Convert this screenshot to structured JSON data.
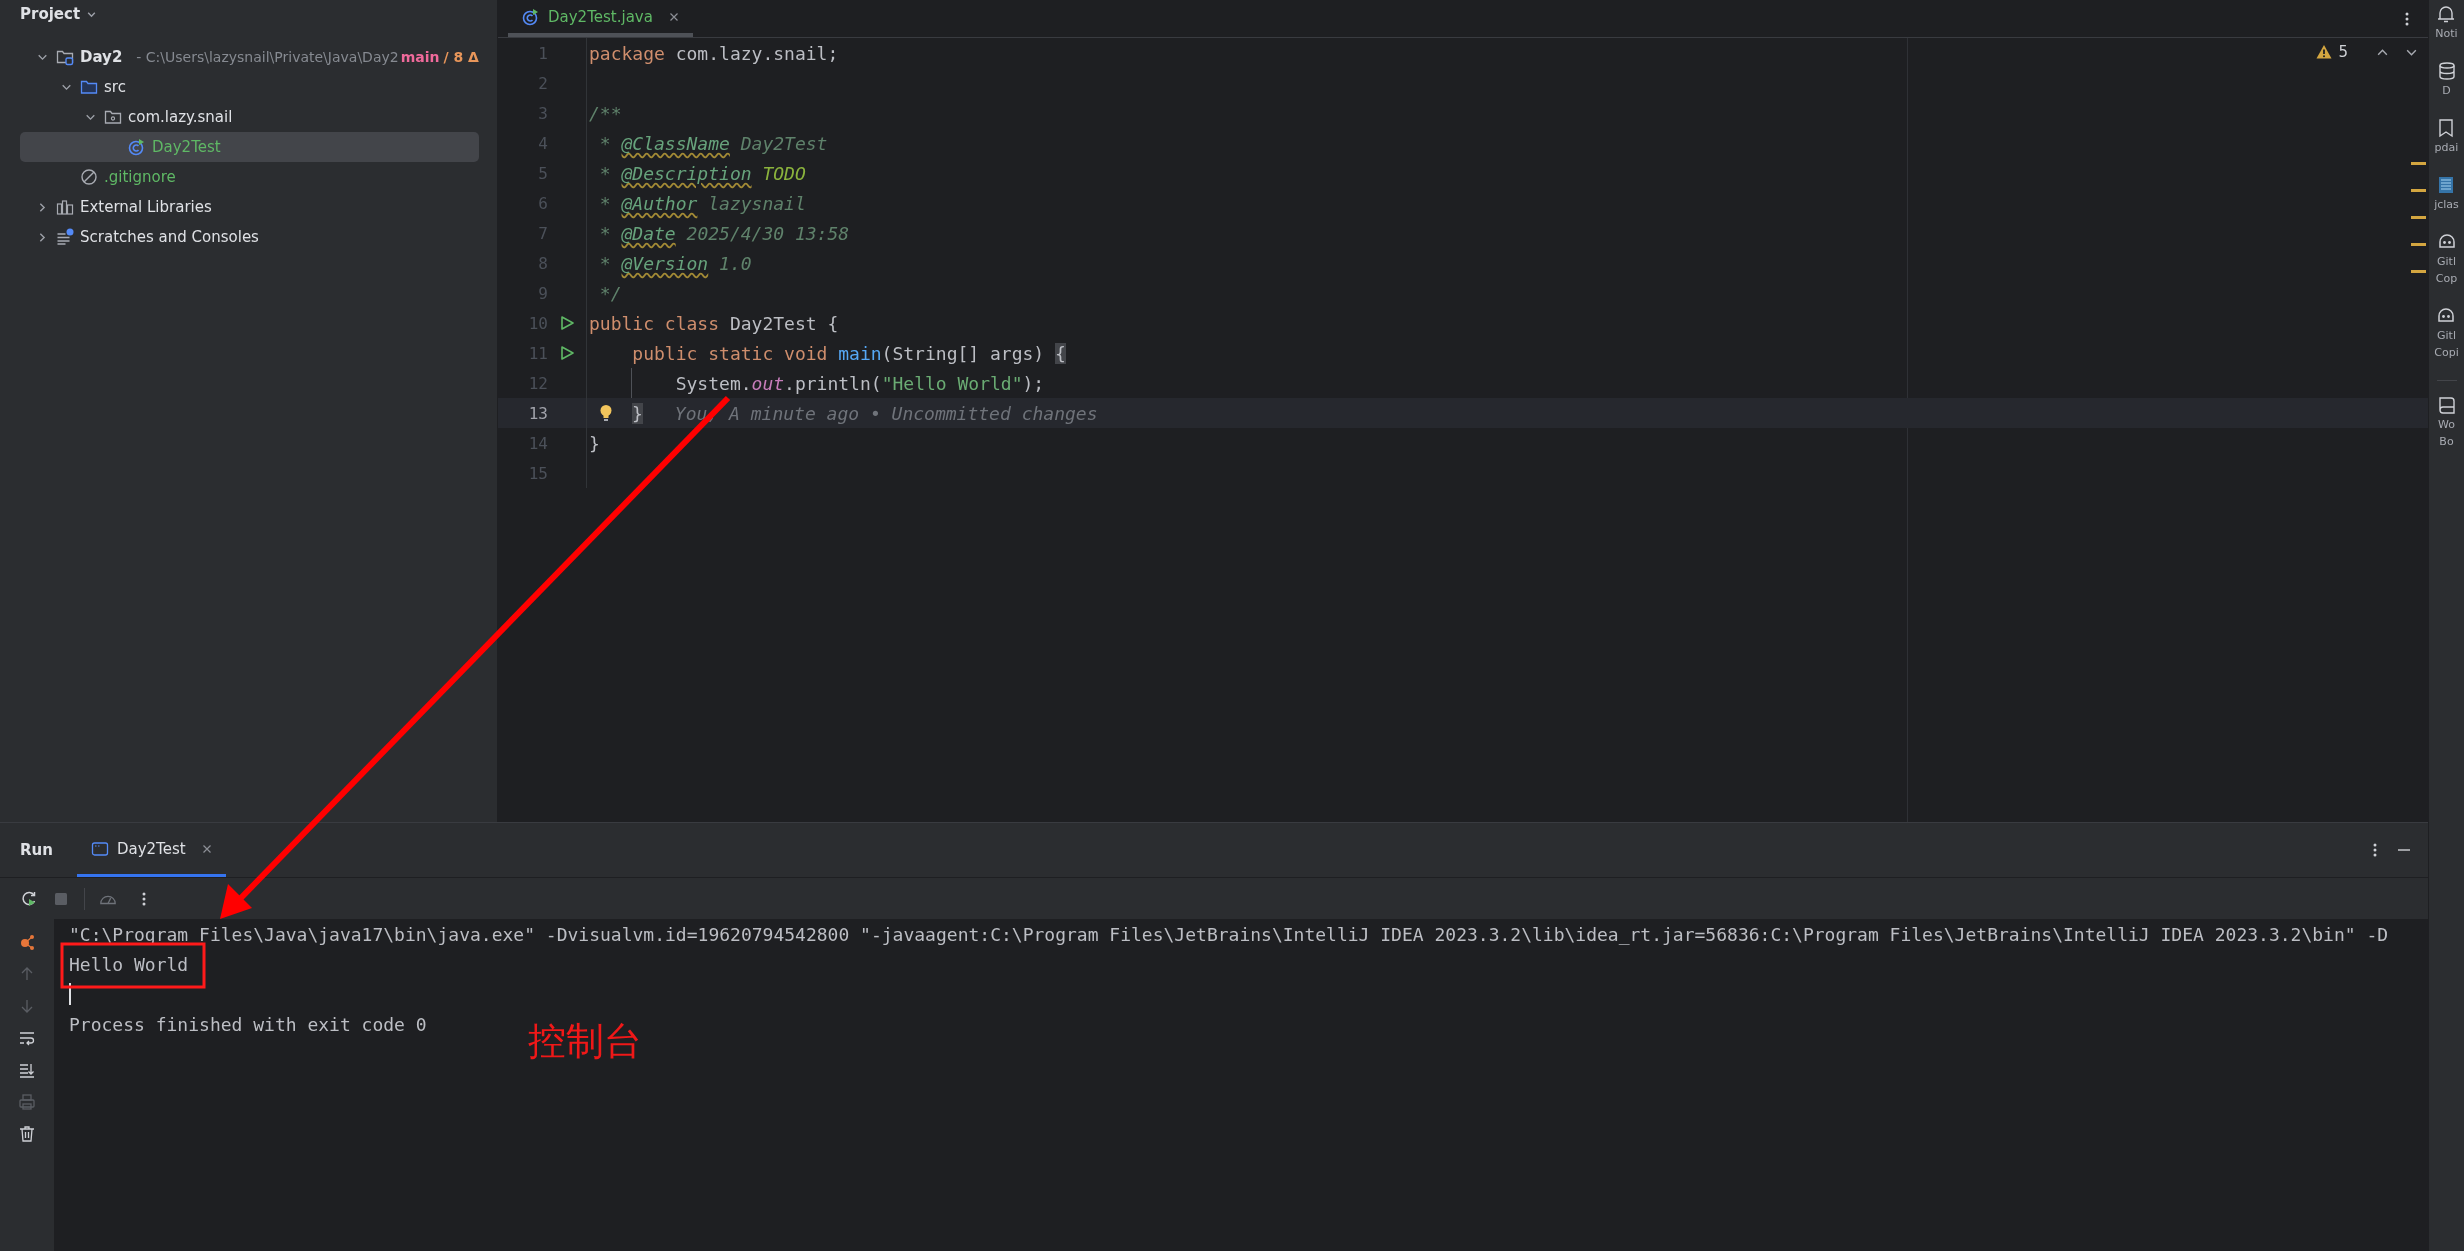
{
  "project_panel": {
    "title": "Project",
    "tree": [
      {
        "name": "Day2",
        "kind": "module",
        "path": "- C:\\Users\\lazysnail\\Private\\Java\\Day2",
        "branch": "main",
        "changes": "/ 8 Δ",
        "expanded": true,
        "selected": false,
        "children": [
          {
            "name": "src",
            "kind": "folder",
            "expanded": true,
            "selected": false,
            "children": [
              {
                "name": "com.lazy.snail",
                "kind": "package",
                "expanded": true,
                "selected": false,
                "children": [
                  {
                    "name": "Day2Test",
                    "kind": "class",
                    "color": "#5fb865",
                    "selected": true
                  }
                ]
              }
            ]
          },
          {
            "name": ".gitignore",
            "kind": "ignore",
            "color": "#5fb865",
            "selected": false
          }
        ]
      },
      {
        "name": "External Libraries",
        "kind": "libraries",
        "expanded": false,
        "selected": false
      },
      {
        "name": "Scratches and Consoles",
        "kind": "scratches",
        "expanded": false,
        "selected": false
      }
    ]
  },
  "editor": {
    "tabs": [
      {
        "label": "Day2Test.java",
        "selected": true
      }
    ],
    "warnings": "5",
    "lines": [
      {
        "number": "1",
        "tokens": [
          {
            "text": "package",
            "kind": "keyword"
          },
          {
            "text": " com.lazy.snail;",
            "kind": "plain"
          }
        ]
      },
      {
        "number": "2"
      },
      {
        "number": "3",
        "tokens": [
          {
            "text": "/**",
            "kind": "doc"
          }
        ]
      },
      {
        "number": "4",
        "tokens": [
          {
            "text": " * ",
            "kind": "doc"
          },
          {
            "text": "@ClassName",
            "kind": "doctag"
          },
          {
            "text": " Day2Test",
            "kind": "doc"
          }
        ]
      },
      {
        "number": "5",
        "tokens": [
          {
            "text": " * ",
            "kind": "doc"
          },
          {
            "text": "@Description",
            "kind": "doctag"
          },
          {
            "text": " TODO",
            "kind": "todo"
          }
        ]
      },
      {
        "number": "6",
        "tokens": [
          {
            "text": " * ",
            "kind": "doc"
          },
          {
            "text": "@Author",
            "kind": "doctag"
          },
          {
            "text": " lazysnail",
            "kind": "doc"
          }
        ]
      },
      {
        "number": "7",
        "tokens": [
          {
            "text": " * ",
            "kind": "doc"
          },
          {
            "text": "@Date",
            "kind": "doctag"
          },
          {
            "text": " 2025/4/30 13:58",
            "kind": "doc"
          }
        ]
      },
      {
        "number": "8",
        "tokens": [
          {
            "text": " * ",
            "kind": "doc"
          },
          {
            "text": "@Version",
            "kind": "doctag"
          },
          {
            "text": " 1.0",
            "kind": "doc"
          }
        ]
      },
      {
        "number": "9",
        "tokens": [
          {
            "text": " */",
            "kind": "doc"
          }
        ]
      },
      {
        "number": "10",
        "run": true,
        "tokens": [
          {
            "text": "public class ",
            "kind": "keyword"
          },
          {
            "text": "Day2Test {",
            "kind": "plain"
          }
        ]
      },
      {
        "number": "11",
        "run": true,
        "tokens": [
          {
            "text": "    public static void ",
            "kind": "keyword"
          },
          {
            "text": "main",
            "kind": "method"
          },
          {
            "text": "(String[] args) ",
            "kind": "plain"
          },
          {
            "text": "{",
            "kind": "brace-match"
          }
        ]
      },
      {
        "number": "12",
        "tokens": [
          {
            "text": "        System.",
            "kind": "plain"
          },
          {
            "text": "out",
            "kind": "field"
          },
          {
            "text": ".println(",
            "kind": "plain"
          },
          {
            "text": "\"Hello World\"",
            "kind": "string"
          },
          {
            "text": ");",
            "kind": "plain"
          }
        ]
      },
      {
        "number": "13",
        "current": true,
        "bulb": true,
        "tokens": [
          {
            "text": "}",
            "kind": "brace-match"
          }
        ],
        "hint": "You, A minute ago • Uncommitted changes"
      },
      {
        "number": "14",
        "tokens": [
          {
            "text": "}",
            "kind": "plain"
          }
        ]
      },
      {
        "number": "15"
      }
    ]
  },
  "tool_strip": [
    {
      "kind": "bell",
      "lines": [
        "Noti"
      ]
    },
    {
      "kind": "database",
      "lines": [
        "D"
      ]
    },
    {
      "kind": "bookmark",
      "lines": [
        "pdai"
      ]
    },
    {
      "kind": "binary",
      "lines": [
        "jclas"
      ]
    },
    {
      "kind": "copilot",
      "lines": [
        "Gitl",
        "Cop"
      ]
    },
    {
      "kind": "copilot",
      "lines": [
        "Gitl",
        "Copi"
      ]
    },
    {
      "kind": "book",
      "lines": [
        "Wo",
        "Bo"
      ]
    }
  ],
  "run_panel": {
    "title": "Run",
    "tabs": [
      {
        "label": "Day2Test",
        "selected": true
      }
    ],
    "console": [
      {
        "kind": "command",
        "text": "\"C:\\Program Files\\Java\\java17\\bin\\java.exe\" -Dvisualvm.id=19620794542800 \"-javaagent:C:\\Program Files\\JetBrains\\IntelliJ IDEA 2023.3.2\\lib\\idea_rt.jar=56836:C:\\Program Files\\JetBrains\\IntelliJ IDEA 2023.3.2\\bin\" -D"
      },
      {
        "kind": "output",
        "text": "Hello World"
      },
      {
        "kind": "cursor"
      },
      {
        "kind": "output",
        "text": "Process finished with exit code 0"
      }
    ]
  },
  "annotation": {
    "label": "控制台"
  }
}
